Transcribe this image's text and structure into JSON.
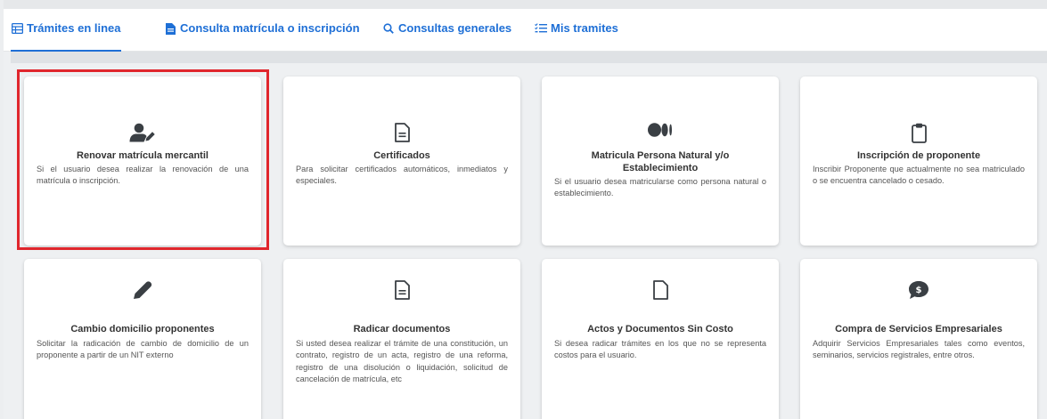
{
  "tabs": [
    {
      "label": "Trámites en linea",
      "icon": "table-icon"
    },
    {
      "label": "Consulta matrícula o inscripción",
      "icon": "document-icon"
    },
    {
      "label": "Consultas generales",
      "icon": "search-icon"
    },
    {
      "label": "Mis tramites",
      "icon": "list-check-icon"
    }
  ],
  "cards": [
    {
      "title": "Renovar matrícula mercantil",
      "description": "Si el usuario desea realizar la renovación de una matrícula o inscripción.",
      "icon": "user-edit-icon"
    },
    {
      "title": "Certificados",
      "description": "Para solicitar certificados automáticos, inmediatos y especiales.",
      "icon": "file-text-icon"
    },
    {
      "title": "Matricula Persona Natural y/o Establecimiento",
      "description": "Si el usuario desea matricularse como persona natural o establecimiento.",
      "icon": "medium-logo-icon"
    },
    {
      "title": "Inscripción de proponente",
      "description": "Inscribir Proponente que actualmente no sea matriculado o se encuentra cancelado o cesado.",
      "icon": "clipboard-icon"
    },
    {
      "title": "Cambio domicilio proponentes",
      "description": "Solicitar la radicación de cambio de domicilio de un proponente a partir de un NIT externo",
      "icon": "pen-icon"
    },
    {
      "title": "Radicar documentos",
      "description": "Si usted desea realizar el trámite de una constitución, un contrato, registro de un acta, registro de una reforma, registro de una disolución o liquidación, solicitud de cancelación de matrícula, etc",
      "icon": "file-text-icon"
    },
    {
      "title": "Actos y Documentos Sin Costo",
      "description": "Si desea radicar trámites en los que no se representa costos para el usuario.",
      "icon": "file-icon"
    },
    {
      "title": "Compra de Servicios Empresariales",
      "description": "Adquirir Servicios Empresariales tales como eventos, seminarios, servicios registrales, entre otros.",
      "icon": "comment-dollar-icon"
    }
  ],
  "colors": {
    "accent": "#1e6fd6",
    "highlight": "#e0262d"
  }
}
